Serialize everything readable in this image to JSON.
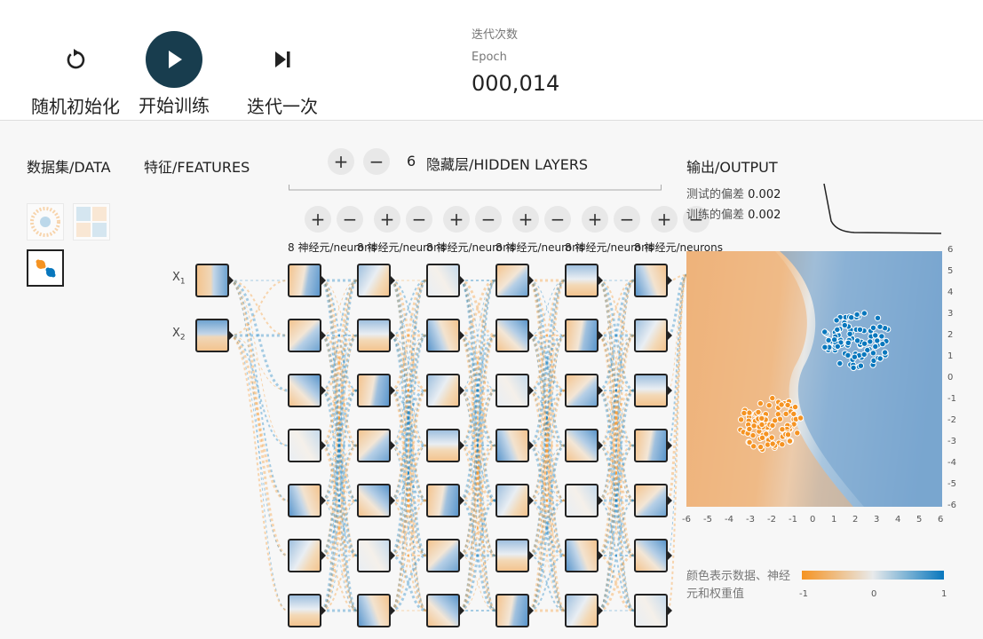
{
  "toolbar": {
    "reset_label": "随机初始化",
    "play_label": "开始训练",
    "step_label": "迭代一次",
    "epoch_label_cn": "迭代次数",
    "epoch_label_en": "Epoch",
    "epoch_value": "000,014"
  },
  "headers": {
    "data": "数据集/DATA",
    "features": "特征/FEATURES",
    "hidden_layers": "隐藏层/HIDDEN LAYERS",
    "output": "输出/OUTPUT"
  },
  "hidden_layer_count": "6",
  "layer_add_symbol": "+",
  "layer_remove_symbol": "−",
  "neuron_label": "8 神经元/neurons",
  "features": [
    {
      "name": "X",
      "sub": "1"
    },
    {
      "name": "X",
      "sub": "2"
    }
  ],
  "output": {
    "test_loss_label": "测试的偏差",
    "test_loss_value": "0.002",
    "train_loss_label": "训练的偏差",
    "train_loss_value": "0.002"
  },
  "x_axis_ticks": [
    "-6",
    "-5",
    "-4",
    "-3",
    "-2",
    "-1",
    "0",
    "1",
    "2",
    "3",
    "4",
    "5",
    "6"
  ],
  "y_axis_ticks": [
    "6",
    "5",
    "4",
    "3",
    "2",
    "1",
    "0",
    "-1",
    "-2",
    "-3",
    "-4",
    "-5",
    "-6"
  ],
  "legend": {
    "text": "颜色表示数据、神经元和权重值",
    "ticks": [
      "-1",
      "0",
      "1"
    ]
  },
  "colors": {
    "orange": "#f59322",
    "blue": "#0877bd",
    "play_button": "#183d4e"
  },
  "icons": {
    "reset": "reset-icon",
    "play": "play-icon",
    "step": "step-icon"
  }
}
